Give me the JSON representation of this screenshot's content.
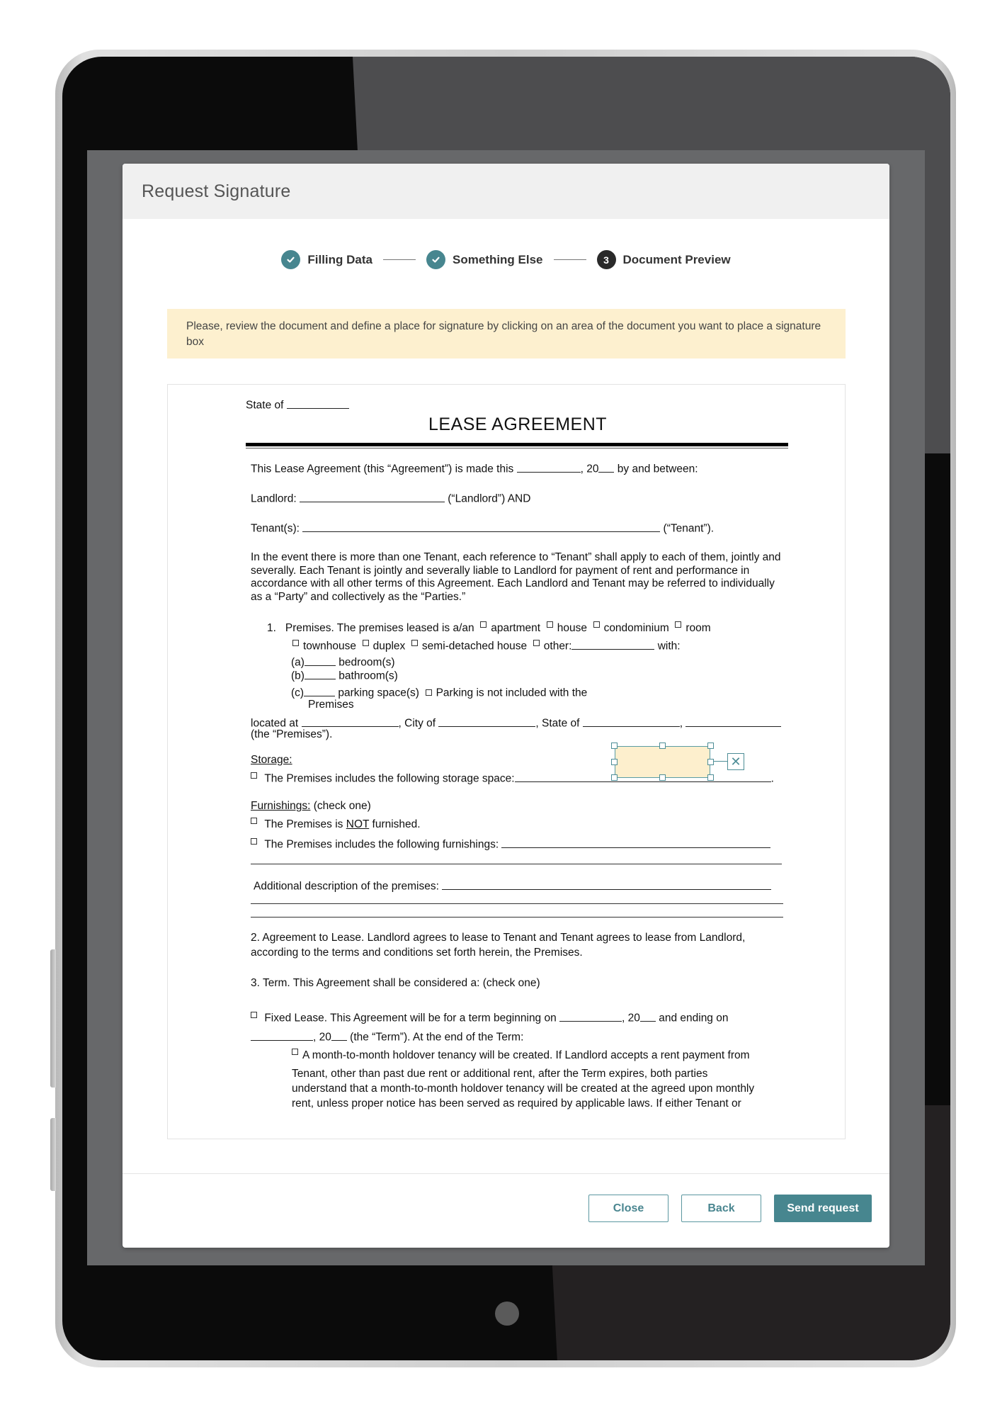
{
  "modal": {
    "title": "Request Signature"
  },
  "stepper": {
    "steps": [
      {
        "label": "Filling Data",
        "status": "done",
        "icon": "check-icon"
      },
      {
        "label": "Something Else",
        "status": "done",
        "icon": "check-icon"
      },
      {
        "label": "Document Preview",
        "status": "current",
        "number": "3"
      }
    ]
  },
  "notice": {
    "text": "Please, review the document and define a place for signature by clicking on an area of the document you want to place a signature box"
  },
  "document": {
    "state_of": "State of",
    "title": "LEASE AGREEMENT",
    "intro_a": "This Lease Agreement (this “Agreement”) is made this",
    "intro_b": ", 20",
    "intro_c": "by and between:",
    "landlord_label": "Landlord:",
    "landlord_suffix": "(“Landlord”) AND",
    "tenant_label": "Tenant(s):",
    "tenant_suffix": "(“Tenant”).",
    "tenant_paragraph": "In the event there is more than one Tenant, each reference to “Tenant” shall apply to each of them, jointly and severally. Each Tenant is jointly and severally liable to Landlord for payment of rent and performance in accordance with all other terms of this Agreement. Each Landlord and Tenant may be referred to individually as a “Party” and collectively as the “Parties.”",
    "premises": {
      "number": "1.",
      "heading": "Premises.",
      "lead": "The premises leased is a/an",
      "options_row1": [
        "apartment",
        "house",
        "condominium",
        "room"
      ],
      "options_row2": [
        "townhouse",
        "duplex",
        "semi-detached house",
        "other:"
      ],
      "with": "with:",
      "a": "(a)",
      "a_label": "bedroom(s)",
      "b": "(b)",
      "b_label": "bathroom(s)",
      "c": "(c)",
      "c_label": "parking space(s)",
      "parking_note": "Parking is not included with the",
      "parking_note_2": "Premises",
      "located_at": "located at",
      "city_of": ", City of",
      "state_of": ", State of",
      "comma": ",",
      "the_premises": "(the “Premises”)."
    },
    "storage": {
      "heading": "Storage:",
      "text": "The Premises includes the following storage space:"
    },
    "furnishings": {
      "heading": "Furnishings:",
      "heading_suffix": "(check one)",
      "not_a": "The Premises is",
      "not_b": "NOT",
      "not_c": "furnished.",
      "includes": "The Premises includes the following furnishings:"
    },
    "additional": "Additional description of the premises:",
    "agreement": {
      "heading": "2. Agreement to Lease.",
      "text_line1": "Landlord agrees to lease to Tenant and Tenant agrees to lease  from Landlord,",
      "text_line2": "according to the terms and conditions set forth herein, the Premises."
    },
    "term": {
      "heading": "3. Term.",
      "text": "This Agreement shall be considered a: (check one)"
    },
    "fixed": {
      "line1_a": "Fixed Lease. This Agreement will be for a term beginning on",
      "line1_b": ", 20",
      "line1_c": "and ending on",
      "line2_a": ", 20",
      "line2_b": "(the “Term”). At the end of the Term:",
      "holdover_line1": "A month-to-month holdover tenancy will be created. If Landlord accepts a rent payment from",
      "holdover_line2": "Tenant, other than past due rent or additional rent, after the Term expires, both parties",
      "holdover_line3": "understand that a month-to-month holdover tenancy will be created at the agreed upon monthly",
      "holdover_line4": "rent, unless proper notice has been served as required by applicable laws. If either Tenant or"
    }
  },
  "signature_box": {
    "remove_glyph": "✕"
  },
  "footer": {
    "close_label": "Close",
    "back_label": "Back",
    "send_label": "Send request"
  },
  "colors": {
    "accent": "#47868f",
    "notice_bg": "#fdf0cf",
    "signature_fill": "#fdefcd"
  }
}
